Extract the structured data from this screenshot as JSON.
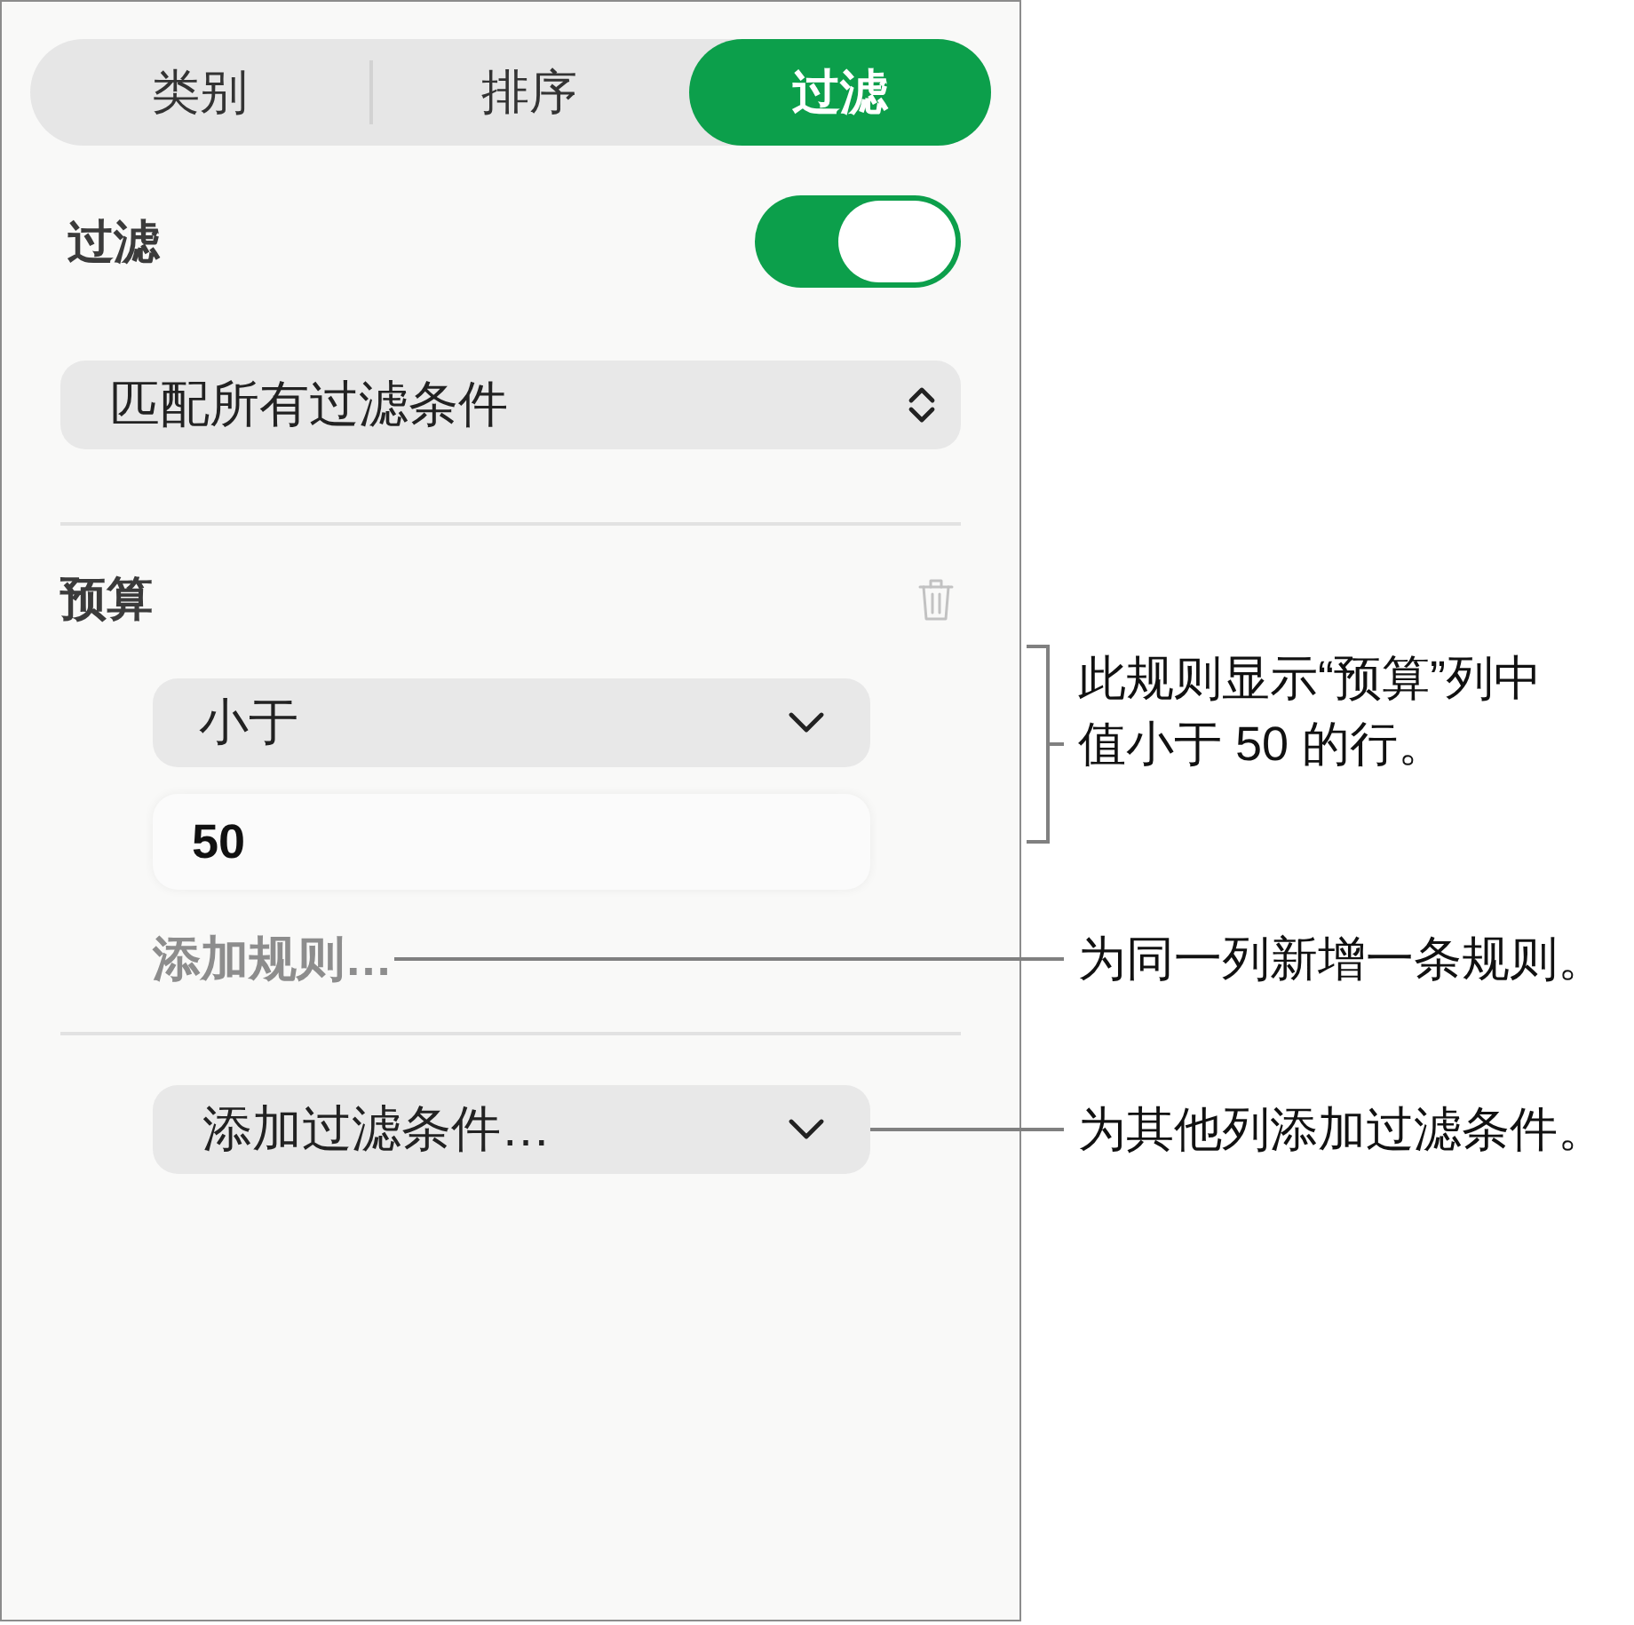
{
  "tabs": [
    {
      "label": "类别",
      "selected": false
    },
    {
      "label": "排序",
      "selected": false
    },
    {
      "label": "过滤",
      "selected": true
    }
  ],
  "filter": {
    "label": "过滤",
    "on": true
  },
  "match_popup": {
    "value": "匹配所有过滤条件"
  },
  "rules": [
    {
      "column": "预算",
      "condition": "小于",
      "value": "50",
      "add_rule": "添加规则…"
    }
  ],
  "add_filter": {
    "label": "添加过滤条件…"
  },
  "callouts": [
    {
      "kind": "bracket",
      "text": "此规则显示“预算”列中值小于 50 的行。"
    },
    {
      "kind": "leader",
      "text": "为同一列新增一条规则。"
    },
    {
      "kind": "leader",
      "text": "为其他列添加过滤条件。"
    }
  ]
}
